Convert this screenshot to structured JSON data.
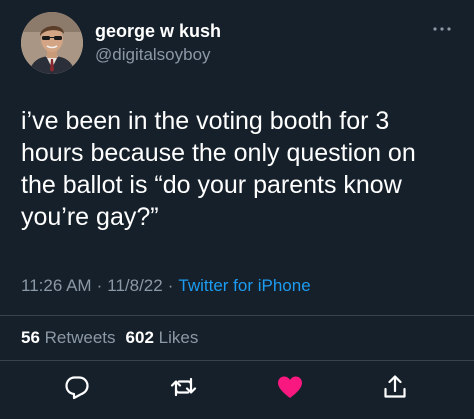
{
  "author": {
    "display_name": "george w kush",
    "handle": "@digitalsoyboy",
    "avatar_icon": "profile-photo"
  },
  "tweet": {
    "lines": [
      "i’ve been in the voting booth for 3",
      "hours because the only question on",
      "the ballot is “do your parents know",
      "you’re gay?”"
    ],
    "time": "11:26 AM",
    "date": "11/8/22",
    "source": "Twitter for iPhone"
  },
  "stats": {
    "retweets_count": "56",
    "retweets_label": "Retweets",
    "likes_count": "602",
    "likes_label": "Likes"
  },
  "actions": {
    "reply_icon": "reply-icon",
    "retweet_icon": "retweet-icon",
    "like_icon": "heart-icon",
    "share_icon": "share-icon"
  },
  "colors": {
    "background": "#15202b",
    "text": "#ffffff",
    "secondary_text": "#8b98a5",
    "link": "#1d9bf0",
    "like": "#f91880",
    "divider": "#38444d"
  }
}
